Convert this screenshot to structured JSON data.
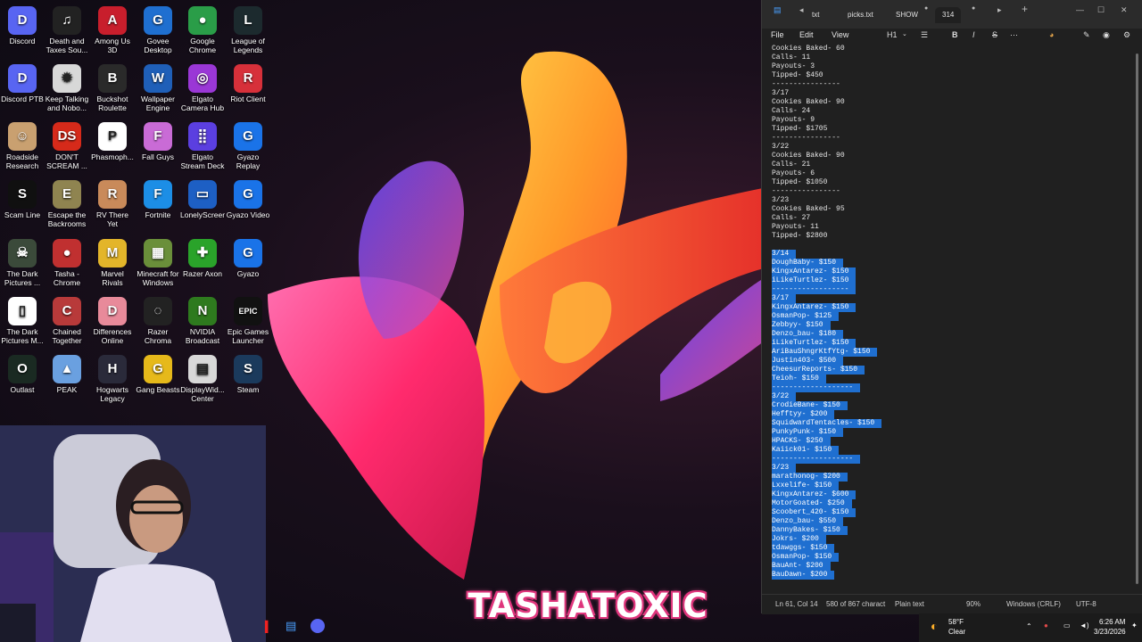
{
  "desktop": {
    "icons": [
      {
        "label": "Discord",
        "glyph": "D",
        "color": "#5865f2"
      },
      {
        "label": "Death and Taxes Sou...",
        "glyph": "♫",
        "color": "#222222"
      },
      {
        "label": "Among Us 3D",
        "glyph": "A",
        "color": "#c81e2c"
      },
      {
        "label": "Govee Desktop",
        "glyph": "G",
        "color": "#1f6fd0"
      },
      {
        "label": "Google Chrome",
        "glyph": "●",
        "color": "#2a9d48"
      },
      {
        "label": "League of Legends",
        "glyph": "L",
        "color": "#1c2a2e"
      },
      {
        "label": "Discord PTB",
        "glyph": "D",
        "color": "#5865f2"
      },
      {
        "label": "Keep Talking and Nobo...",
        "glyph": "✹",
        "color": "#d8d8d8"
      },
      {
        "label": "Buckshot Roulette",
        "glyph": "B",
        "color": "#2a2a2a"
      },
      {
        "label": "Wallpaper Engine",
        "glyph": "W",
        "color": "#1f5fb8"
      },
      {
        "label": "Elgato Camera Hub",
        "glyph": "◎",
        "color": "#9a37d6"
      },
      {
        "label": "Riot Client",
        "glyph": "R",
        "color": "#d7303a"
      },
      {
        "label": "Roadside Research",
        "glyph": "☺",
        "color": "#c9a070"
      },
      {
        "label": "DON'T SCREAM ...",
        "glyph": "DS",
        "color": "#d62a1a"
      },
      {
        "label": "Phasmoph...",
        "glyph": "P",
        "color": "#ffffff"
      },
      {
        "label": "Fall Guys",
        "glyph": "F",
        "color": "#c96bd6"
      },
      {
        "label": "Elgato Stream Deck",
        "glyph": "⣿",
        "color": "#5b3fe0"
      },
      {
        "label": "Gyazo Replay",
        "glyph": "G",
        "color": "#1a73e8"
      },
      {
        "label": "Scam Line",
        "glyph": "S",
        "color": "#101010"
      },
      {
        "label": "Escape the Backrooms",
        "glyph": "E",
        "color": "#8f8450"
      },
      {
        "label": "RV There Yet",
        "glyph": "R",
        "color": "#c98a5a"
      },
      {
        "label": "Fortnite",
        "glyph": "F",
        "color": "#1c8ee6"
      },
      {
        "label": "LonelyScreen",
        "glyph": "▭",
        "color": "#1d5fc4"
      },
      {
        "label": "Gyazo Video",
        "glyph": "G",
        "color": "#1a73e8"
      },
      {
        "label": "The Dark Pictures ...",
        "glyph": "☠",
        "color": "#3b4a3a"
      },
      {
        "label": "Tasha - Chrome",
        "glyph": "●",
        "color": "#c03030"
      },
      {
        "label": "Marvel Rivals",
        "glyph": "M",
        "color": "#e3b52a"
      },
      {
        "label": "Minecraft for Windows",
        "glyph": "▦",
        "color": "#6a8f3a"
      },
      {
        "label": "Razer Axon",
        "glyph": "✚",
        "color": "#2aa32a"
      },
      {
        "label": "Gyazo",
        "glyph": "G",
        "color": "#1a73e8"
      },
      {
        "label": "The Dark Pictures M...",
        "glyph": "▯",
        "color": "#ffffff"
      },
      {
        "label": "Chained Together",
        "glyph": "C",
        "color": "#b83a3a"
      },
      {
        "label": "Differences Online",
        "glyph": "D",
        "color": "#e88a9a"
      },
      {
        "label": "Razer Chroma",
        "glyph": "◌",
        "color": "#222222"
      },
      {
        "label": "NVIDIA Broadcast",
        "glyph": "N",
        "color": "#2e7a1e"
      },
      {
        "label": "Epic Games Launcher",
        "glyph": "EPIC",
        "color": "#111111"
      },
      {
        "label": "Outlast",
        "glyph": "O",
        "color": "#1a2a22"
      },
      {
        "label": "PEAK",
        "glyph": "▲",
        "color": "#6aa0e0"
      },
      {
        "label": "Hogwarts Legacy",
        "glyph": "H",
        "color": "#2a2a3a"
      },
      {
        "label": "Gang Beasts",
        "glyph": "G",
        "color": "#e6b91a"
      },
      {
        "label": "DisplayWid... Center",
        "glyph": "▤",
        "color": "#d8d8d8"
      },
      {
        "label": "Steam",
        "glyph": "S",
        "color": "#1b3a5c"
      }
    ]
  },
  "brand": {
    "text": "TASHATOXIC"
  },
  "notepad": {
    "tabs": [
      {
        "label": "txt"
      },
      {
        "label": "picks.txt"
      },
      {
        "label": "SHOW"
      },
      {
        "label": "314"
      }
    ],
    "menu": {
      "file": "File",
      "edit": "Edit",
      "view": "View"
    },
    "format": {
      "heading": "H1",
      "bold": "B",
      "italic": "I",
      "strike": "S"
    },
    "lines": [
      {
        "text": "Cookies Baked- 60",
        "sel": false
      },
      {
        "text": "Calls- 11",
        "sel": false
      },
      {
        "text": "Payouts- 3",
        "sel": false
      },
      {
        "text": "Tipped- $450",
        "sel": false
      },
      {
        "text": "----------------",
        "sel": false
      },
      {
        "text": "3/17",
        "sel": false
      },
      {
        "text": "Cookies Baked- 90",
        "sel": false
      },
      {
        "text": "Calls- 24",
        "sel": false
      },
      {
        "text": "Payouts- 9",
        "sel": false
      },
      {
        "text": "Tipped- $1705",
        "sel": false
      },
      {
        "text": "----------------",
        "sel": false
      },
      {
        "text": "3/22",
        "sel": false
      },
      {
        "text": "Cookies Baked- 90",
        "sel": false
      },
      {
        "text": "Calls- 21",
        "sel": false
      },
      {
        "text": "Payouts- 6",
        "sel": false
      },
      {
        "text": "Tipped- $1050",
        "sel": false
      },
      {
        "text": "----------------",
        "sel": false
      },
      {
        "text": "3/23",
        "sel": false
      },
      {
        "text": "Cookies Baked- 95",
        "sel": false
      },
      {
        "text": "Calls- 27",
        "sel": false
      },
      {
        "text": "Payouts- 11",
        "sel": false
      },
      {
        "text": "Tipped- $2800",
        "sel": false
      },
      {
        "text": "",
        "sel": false
      },
      {
        "text": "3/14",
        "sel": true
      },
      {
        "text": "DoughBaby- $150",
        "sel": true
      },
      {
        "text": "KingxAntarez- $150",
        "sel": true
      },
      {
        "text": "iLikeTurtlez- $150",
        "sel": true
      },
      {
        "text": "------------------",
        "sel": true
      },
      {
        "text": "3/17",
        "sel": true
      },
      {
        "text": "KingxAntarez- $150",
        "sel": true
      },
      {
        "text": "OsmanPop- $125",
        "sel": true
      },
      {
        "text": "Zebbyy- $150",
        "sel": true
      },
      {
        "text": "Denzo_bau- $180",
        "sel": true
      },
      {
        "text": "iLikeTurtlez- $150",
        "sel": true
      },
      {
        "text": "AriBauShngrKtfYtg- $150",
        "sel": true
      },
      {
        "text": "Justin403- $500",
        "sel": true
      },
      {
        "text": "CheesurReports- $150",
        "sel": true
      },
      {
        "text": "Teioh- $150",
        "sel": true
      },
      {
        "text": "-------------------",
        "sel": true
      },
      {
        "text": "3/22",
        "sel": true
      },
      {
        "text": "CrodieBane- $150",
        "sel": true
      },
      {
        "text": "Hefftyy- $200",
        "sel": true
      },
      {
        "text": "SquidwardTentacles- $150",
        "sel": true
      },
      {
        "text": "PunkyPunk- $150",
        "sel": true
      },
      {
        "text": "HPACKS- $250",
        "sel": true
      },
      {
        "text": "Kaiick01- $150",
        "sel": true
      },
      {
        "text": "-------------------",
        "sel": true
      },
      {
        "text": "3/23",
        "sel": true
      },
      {
        "text": "marathonog- $200",
        "sel": true
      },
      {
        "text": "Lxxelife- $150",
        "sel": true
      },
      {
        "text": "KingxAntarez- $600",
        "sel": true
      },
      {
        "text": "MotorGoated- $250",
        "sel": true
      },
      {
        "text": "Scoobert_420- $150",
        "sel": true
      },
      {
        "text": "Denzo_bau- $550",
        "sel": true
      },
      {
        "text": "DannyBakes- $150",
        "sel": true
      },
      {
        "text": "Jokrs- $200",
        "sel": true
      },
      {
        "text": "tdawggs- $150",
        "sel": true
      },
      {
        "text": "OsmanPop- $150",
        "sel": true
      },
      {
        "text": "BauAnt- $200",
        "sel": true
      },
      {
        "text": "BauDawn- $200",
        "sel": true
      }
    ],
    "status": {
      "position": "Ln 61, Col 14",
      "chars": "580 of 867 charact",
      "format": "Plain text",
      "zoom": "90%",
      "line_endings": "Windows (CRLF)",
      "encoding": "UTF-8"
    }
  },
  "tray": {
    "temperature": "58°F",
    "weather": "Clear",
    "time": "6:26 AM",
    "date": "3/23/2026"
  }
}
